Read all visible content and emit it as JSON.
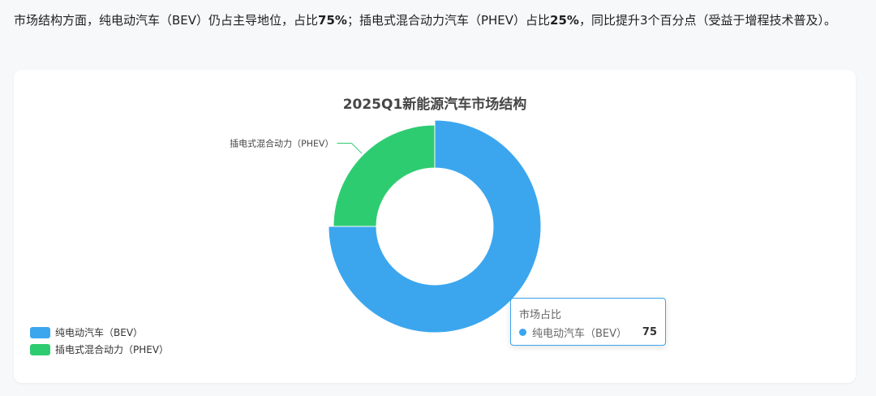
{
  "intro": {
    "p1": "市场结构方面，纯电动汽车（BEV）仍占主导地位，占比",
    "b1": "75%",
    "p2": "；插电式混合动力汽车（PHEV）占比",
    "b2": "25%",
    "p3": "，同比提升3个百分点（受益于增程技术普及）。"
  },
  "chart_data": {
    "type": "pie",
    "title": "2025Q1新能源汽车市场结构",
    "series_name": "市场占比",
    "slices": [
      {
        "name": "纯电动汽车（BEV）",
        "value": 75,
        "color": "#3ba6ee"
      },
      {
        "name": "插电式混合动力（PHEV）",
        "value": 25,
        "color": "#2ecc71"
      }
    ],
    "donut": true,
    "legend_position": "bottom-left",
    "highlighted": "纯电动汽车（BEV）"
  },
  "tooltip": {
    "title": "市场占比",
    "name": "纯电动汽车（BEV）",
    "value": "75"
  }
}
